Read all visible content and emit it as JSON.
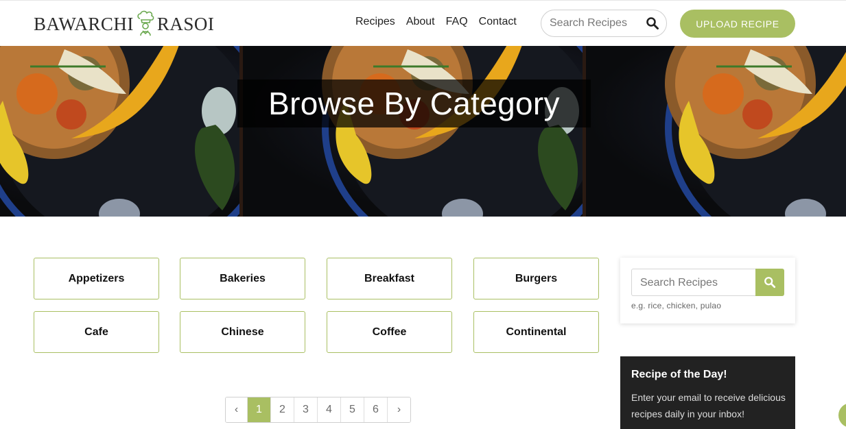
{
  "header": {
    "logo_left": "BAWARCHI",
    "logo_right": "RASOI",
    "nav": [
      "Recipes",
      "About",
      "FAQ",
      "Contact"
    ],
    "search_placeholder": "Search Recipes",
    "upload_label": "UPLOAD RECIPE"
  },
  "hero": {
    "title": "Browse By Category"
  },
  "categories": [
    "Appetizers",
    "Bakeries",
    "Breakfast",
    "Burgers",
    "Cafe",
    "Chinese",
    "Coffee",
    "Continental"
  ],
  "pagination": {
    "prev": "‹",
    "pages": [
      "1",
      "2",
      "3",
      "4",
      "5",
      "6"
    ],
    "next": "›",
    "current": "1"
  },
  "sidebar": {
    "search_placeholder": "Search Recipes",
    "search_hint": "e.g. rice, chicken, pulao",
    "rotd_title": "Recipe of the Day!",
    "rotd_text": "Enter your email to receive delicious recipes daily in your inbox!"
  },
  "colors": {
    "accent": "#a9bf62",
    "dark": "#222222"
  },
  "icons": {
    "search": "search-icon",
    "logo": "chef-hat-icon"
  }
}
